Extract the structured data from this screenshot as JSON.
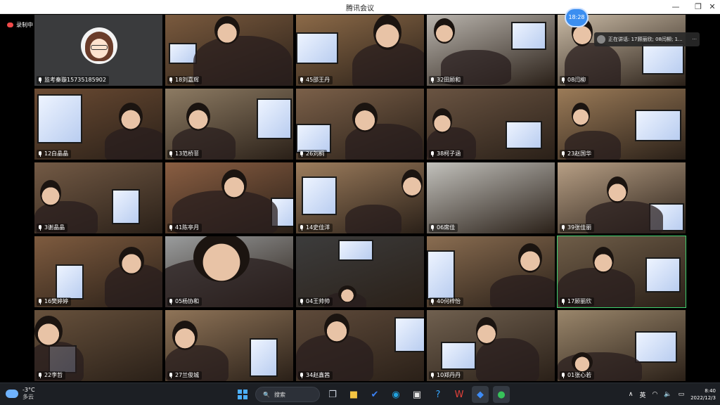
{
  "window": {
    "title": "腾讯会议",
    "min_icon": "minimize-icon",
    "max_icon": "maximize-icon",
    "close_icon": "close-icon"
  },
  "status": {
    "recording_label": "录制中",
    "meeting_time": "18:28",
    "speaking_text": "正在讲话: 17顾丽欣; 08闫柳; 1...",
    "more_glyph": "···"
  },
  "tiles": [
    {
      "name": "监考秦璇15735185902",
      "bg": "#3a3b3d",
      "host": true
    },
    {
      "name": "18刘嘉辉",
      "bg": "#7a5a3e"
    },
    {
      "name": "45邵王丹",
      "bg": "#8c6a48"
    },
    {
      "name": "32田顾和",
      "bg": "#b9b4ad"
    },
    {
      "name": "08闫柳",
      "bg": "#c8b9a4"
    },
    {
      "name": "12白晶晶",
      "bg": "#6b4b33"
    },
    {
      "name": "13范桥菲",
      "bg": "#8d7b63"
    },
    {
      "name": "26刘桐",
      "bg": "#7b6049"
    },
    {
      "name": "38柯子涵",
      "bg": "#6a5442"
    },
    {
      "name": "23赵国华",
      "bg": "#9b7b58"
    },
    {
      "name": "3谢晶晶",
      "bg": "#735a45"
    },
    {
      "name": "41陈亭月",
      "bg": "#8a5e42"
    },
    {
      "name": "14史佳洋",
      "bg": "#9d7d5d"
    },
    {
      "name": "06席佳",
      "bg": "#c2c1bc"
    },
    {
      "name": "39张佳丽",
      "bg": "#b79f85"
    },
    {
      "name": "16樊婷婷",
      "bg": "#7e5b3f"
    },
    {
      "name": "05杨协和",
      "bg": "#9a9c9d"
    },
    {
      "name": "04王帅帅",
      "bg": "#3c3c3c"
    },
    {
      "name": "40何梓怡",
      "bg": "#8a6d51"
    },
    {
      "name": "17顾丽欣",
      "bg": "#6f5d48",
      "active": true
    },
    {
      "name": "22李哲",
      "bg": "#67513c"
    },
    {
      "name": "27兰俊城",
      "bg": "#8f7458"
    },
    {
      "name": "34赵鑫茜",
      "bg": "#5e4a3a"
    },
    {
      "name": "10郑丹丹",
      "bg": "#70604f"
    },
    {
      "name": "01张心若",
      "bg": "#9a866b"
    }
  ],
  "taskbar": {
    "weather_temp": "-3°C",
    "weather_desc": "多云",
    "search_label": "搜索",
    "ime_label": "英",
    "time": "8:40",
    "date": "2022/12/3",
    "search_icon": "🔍",
    "tray_chevron": "∧",
    "wifi_glyph": "◠",
    "volume_glyph": "🔈",
    "battery_glyph": "▭",
    "apps": [
      {
        "name": "task-view-icon",
        "glyph": "❐",
        "color": "#cfd6e0"
      },
      {
        "name": "file-explorer-icon",
        "glyph": "■",
        "color": "#f5c542"
      },
      {
        "name": "todo-icon",
        "glyph": "✔",
        "color": "#3b82f6"
      },
      {
        "name": "edge-browser-icon",
        "glyph": "◉",
        "color": "#21a3e0"
      },
      {
        "name": "store-icon",
        "glyph": "▣",
        "color": "#e8e8e8"
      },
      {
        "name": "help-icon",
        "glyph": "?",
        "color": "#34a6ff"
      },
      {
        "name": "wps-icon",
        "glyph": "W",
        "color": "#e3413a"
      },
      {
        "name": "tencent-meeting-icon",
        "glyph": "◆",
        "color": "#3d8cf7"
      },
      {
        "name": "wechat-icon",
        "glyph": "●",
        "color": "#37c25a"
      }
    ]
  }
}
